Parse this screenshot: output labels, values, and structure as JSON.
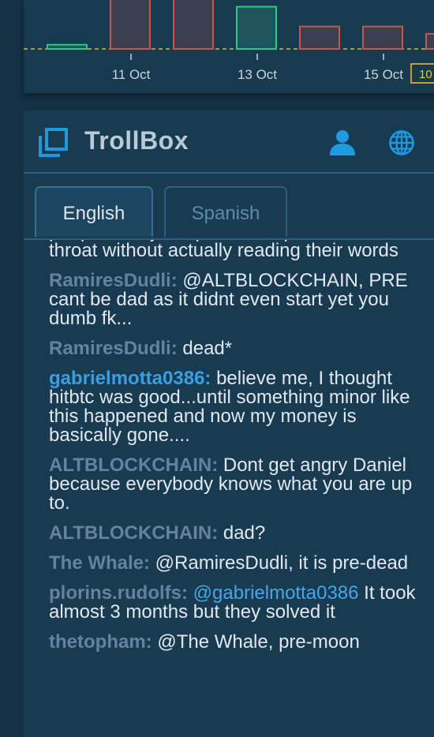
{
  "chart": {
    "x_labels": [
      "11 Oct",
      "13 Oct",
      "15 Oct"
    ],
    "price_tag": "10",
    "colors": {
      "up": "#35c48a",
      "down": "#c75651",
      "baseline": "#d4bb3c",
      "tick": "#c9d4dc"
    },
    "candles": [
      {
        "trend": "up",
        "top_value": 0.08,
        "bottom_value": 0.0
      },
      {
        "trend": "down",
        "top_value": 1.0,
        "bottom_value": 0.0
      },
      {
        "trend": "down",
        "top_value": 0.97,
        "bottom_value": 0.0
      },
      {
        "trend": "up",
        "top_value": 0.81,
        "bottom_value": 0.0
      },
      {
        "trend": "down",
        "top_value": 0.43,
        "bottom_value": 0.0
      },
      {
        "trend": "down",
        "top_value": 0.43,
        "bottom_value": 0.0
      },
      {
        "trend": "down",
        "top_value": 0.29,
        "bottom_value": 0.0
      }
    ]
  },
  "trollbox": {
    "title": "TrollBox",
    "icons": {
      "logo": "trollbox-logo-icon",
      "user": "user-icon",
      "globe": "globe-icon"
    },
    "colors": {
      "accent": "#1f9ae0",
      "username": "#63849c",
      "mention": "#46a6e6"
    },
    "tabs": [
      {
        "label": "English",
        "active": true
      },
      {
        "label": "Spanish",
        "active": false
      }
    ],
    "messages": [
      {
        "user": "",
        "text": "people who just speak their place down the throat without actually reading their words"
      },
      {
        "user": "RamiresDudli:",
        "text": " @ALTBLOCKCHAIN, PRE cant be dad as it didnt even start yet you dumb fk..."
      },
      {
        "user": "RamiresDudli:",
        "text": " dead*"
      },
      {
        "user": "gabrielmotta0386:",
        "highlight": true,
        "text": " believe me, I thought hitbtc was good...until something minor like this happened and now my money is basically gone...."
      },
      {
        "user": "ALTBLOCKCHAIN:",
        "text": " Dont get angry Daniel because everybody knows what you are up to."
      },
      {
        "user": "ALTBLOCKCHAIN:",
        "text": " dad?"
      },
      {
        "user": "The Whale:",
        "text": " @RamiresDudli, it is pre-dead"
      },
      {
        "user": "plorins.rudolfs:",
        "mention": " @gabrielmotta0386",
        "text": " It took almost 3 months but they solved it"
      },
      {
        "user": "thetopham:",
        "text": " @The Whale, pre-moon"
      }
    ]
  }
}
